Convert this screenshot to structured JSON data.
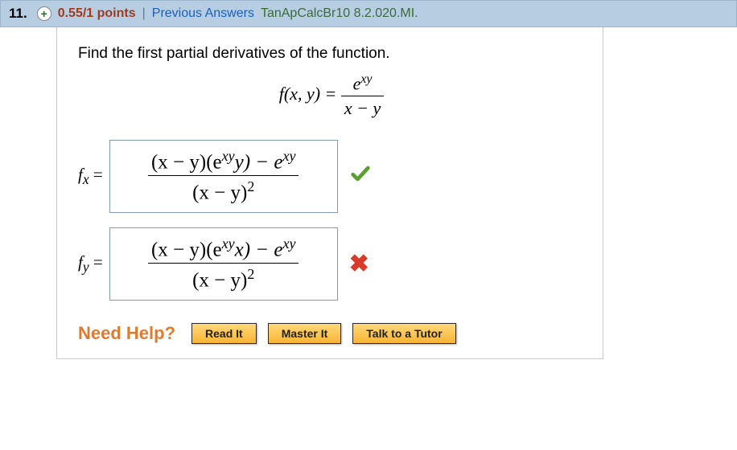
{
  "header": {
    "number": "11.",
    "plus_glyph": "+",
    "points": "0.55/1 points",
    "separator": "|",
    "prev_answers": "Previous Answers",
    "book_ref": "TanApCalcBr10 8.2.020.MI."
  },
  "prompt": "Find the first partial derivatives of the function.",
  "function": {
    "lhs": "f(x, y) = ",
    "num": "e",
    "num_sup": "xy",
    "den": "x − y"
  },
  "answers": {
    "fx": {
      "label_main": "f",
      "label_sub": "x",
      "label_eq": " = ",
      "num_part1": "(x − y)(e",
      "num_sup1": "xy",
      "num_part2": "y) − e",
      "num_sup2": "xy",
      "den_part1": "(x − y)",
      "den_sup": "2",
      "correct": true
    },
    "fy": {
      "label_main": "f",
      "label_sub": "y",
      "label_eq": " = ",
      "num_part1": "(x − y)(e",
      "num_sup1": "xy",
      "num_part2": "x) − e",
      "num_sup2": "xy",
      "den_part1": "(x − y)",
      "den_sup": "2",
      "correct": false
    }
  },
  "help": {
    "label": "Need Help?",
    "read": "Read It",
    "master": "Master It",
    "tutor": "Talk to a Tutor"
  },
  "marks": {
    "incorrect": "✖"
  }
}
